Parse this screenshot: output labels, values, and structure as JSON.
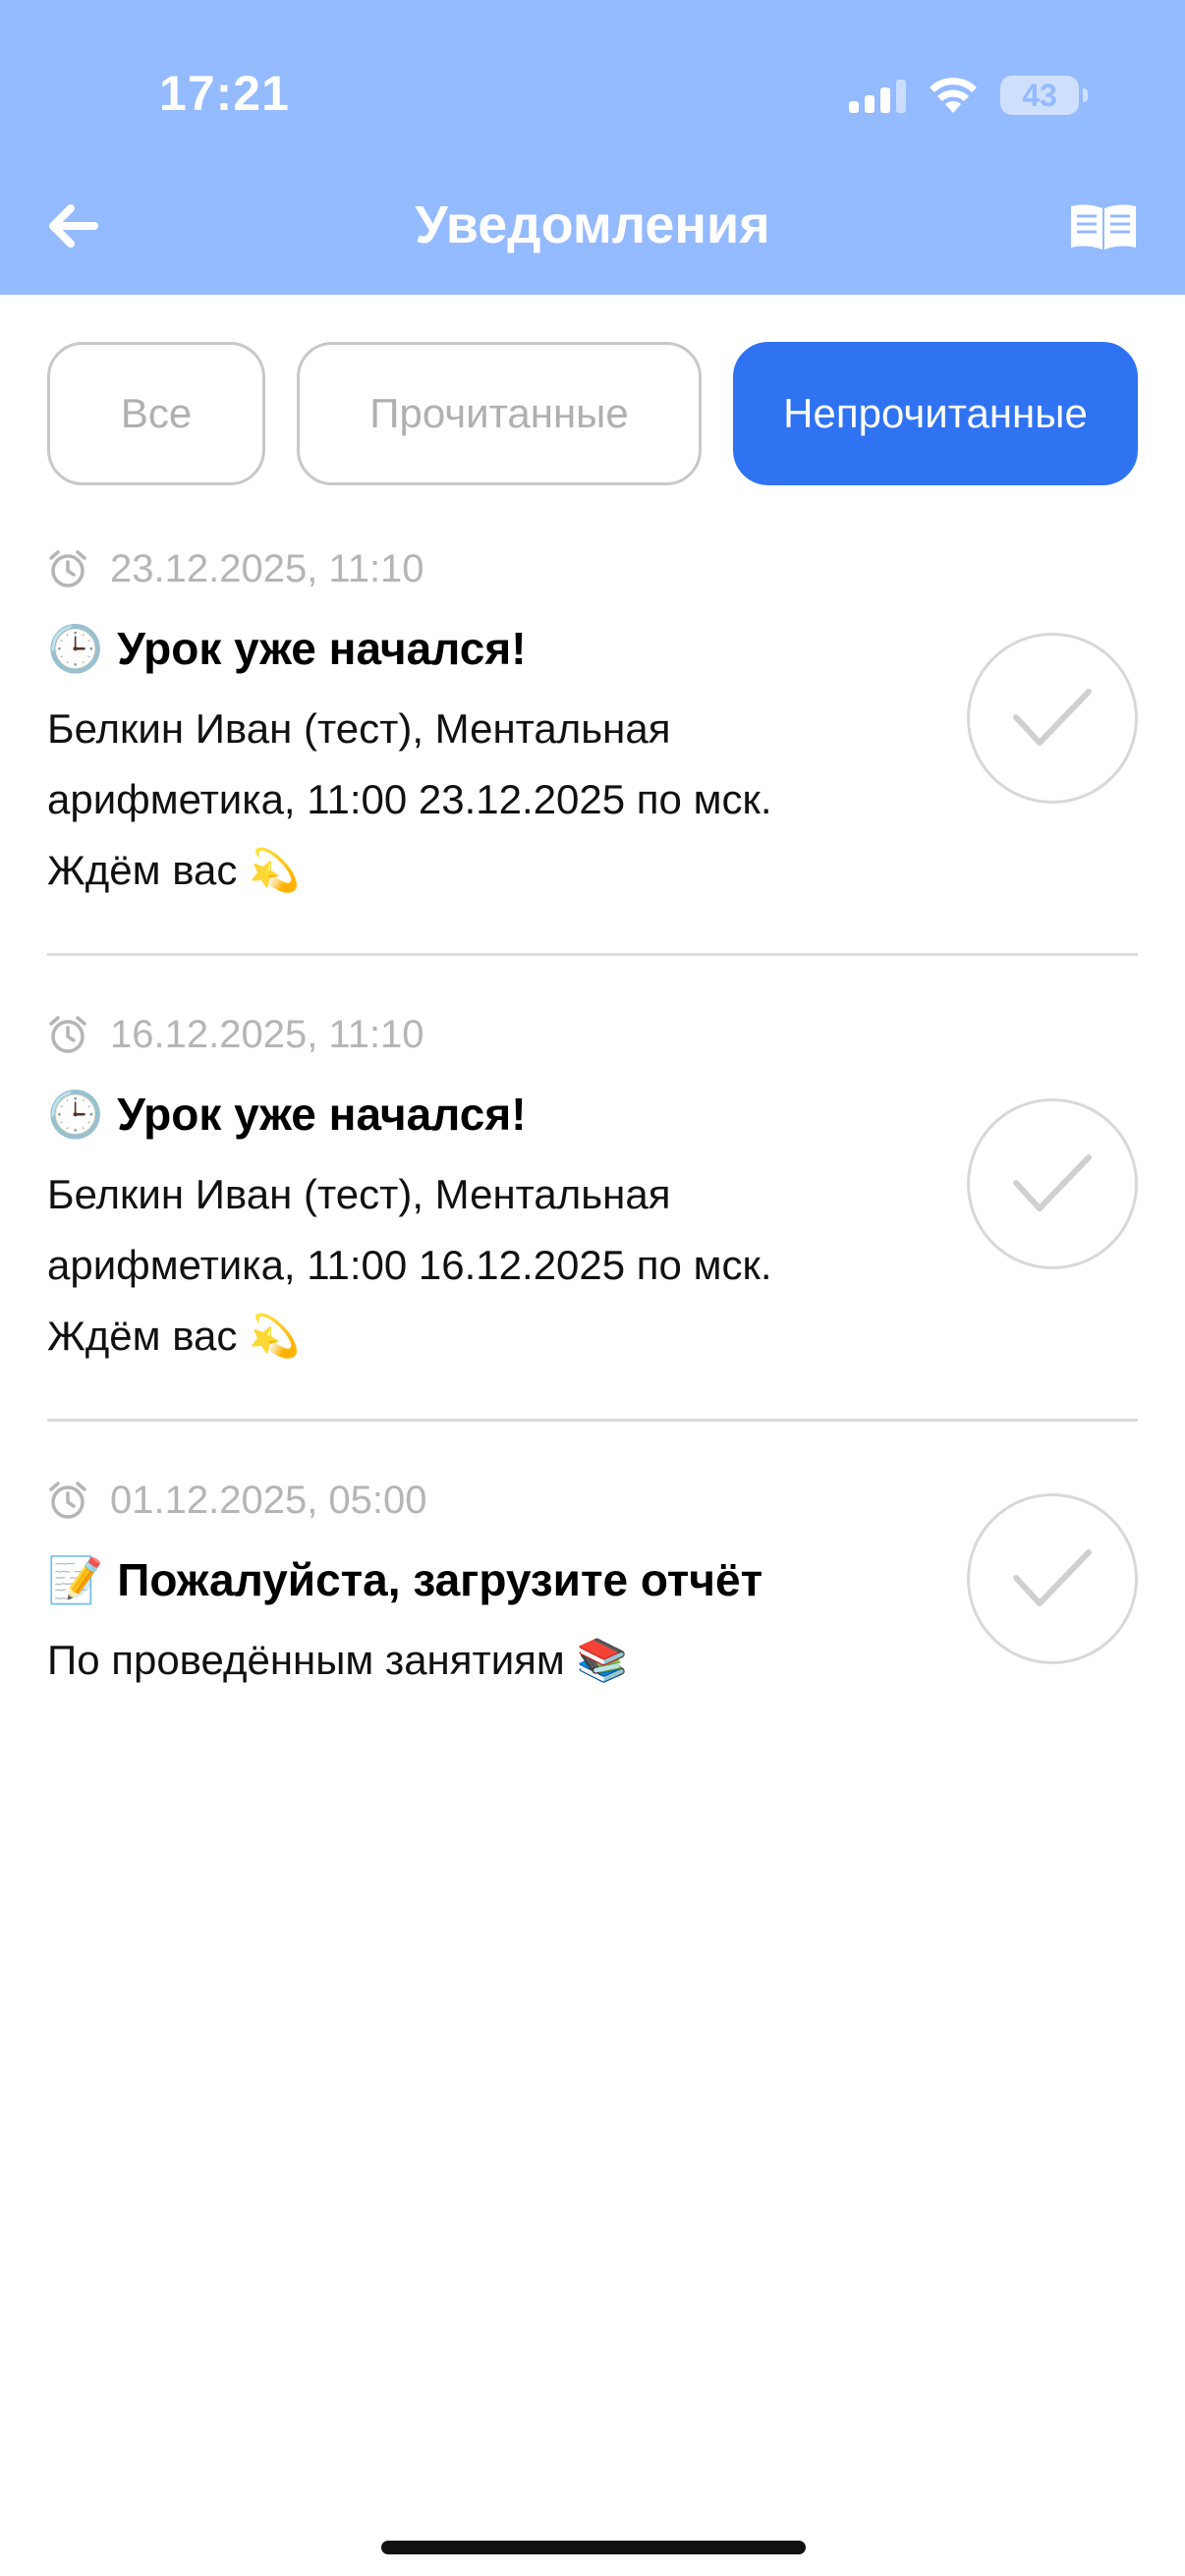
{
  "status_bar": {
    "time": "17:21",
    "battery": "43"
  },
  "header": {
    "title": "Уведомления"
  },
  "filters": [
    {
      "label": "Все",
      "active": false
    },
    {
      "label": "Прочитанные",
      "active": false
    },
    {
      "label": "Непрочитанные",
      "active": true
    }
  ],
  "notifications": [
    {
      "timestamp": "23.12.2025, 11:10",
      "emoji": "🕒",
      "title": "Урок уже начался!",
      "body_line1": "Белкин Иван (тест), Ментальная",
      "body_line2": "арифметика, 11:00 23.12.2025 по мск.",
      "body_line3": "Ждём вас 💫"
    },
    {
      "timestamp": "16.12.2025, 11:10",
      "emoji": "🕒",
      "title": "Урок уже начался!",
      "body_line1": "Белкин Иван (тест), Ментальная",
      "body_line2": "арифметика, 11:00 16.12.2025 по мск.",
      "body_line3": "Ждём вас 💫"
    },
    {
      "timestamp": "01.12.2025, 05:00",
      "emoji": "📝",
      "title": "Пожалуйста, загрузите отчёт",
      "body_line1": "По проведённым занятиям 📚"
    }
  ],
  "colors": {
    "header_bg": "#94baff",
    "accent": "#2f73f2",
    "muted_text": "#b5b5b5"
  },
  "icons": {
    "back": "arrow-left-icon",
    "book": "open-book-icon",
    "clock": "alarm-clock-icon",
    "check": "checkmark-icon"
  }
}
